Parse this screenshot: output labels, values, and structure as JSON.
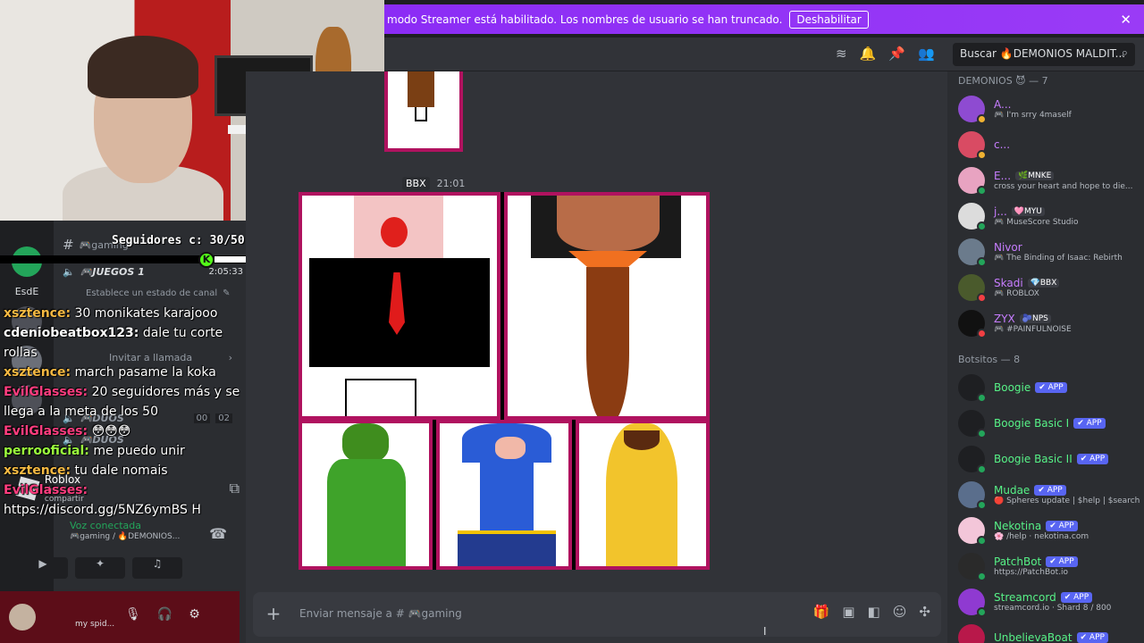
{
  "banner": {
    "text": "modo Streamer está habilitado. Los nombres de usuario se han truncado.",
    "button": "Deshabilitar",
    "close_icon": "close-icon"
  },
  "header": {
    "search_text": "Buscar 🔥DEMONIOS MALDIT..."
  },
  "stream_overlay": {
    "followers_label": "Seguidores c: 30/50",
    "followers_progress": 0.6,
    "followers_dot": "K"
  },
  "channels": {
    "items": [
      {
        "label": "🎮gaming"
      },
      {
        "label": "🎮JUEGOS 1"
      },
      {
        "label": "Establece un estado de canal"
      },
      {
        "label": "Invitar a llamada"
      },
      {
        "label": "🎮DUOS"
      },
      {
        "label": "🎮DUOS"
      }
    ],
    "time_code": "2:05:33",
    "duo_count_a": "00",
    "duo_count_b": "02",
    "server_label": "EsdE"
  },
  "chat_overlay": [
    {
      "user": "xsztence:",
      "text": "30 monikates karajooo",
      "color": "#f5b942"
    },
    {
      "user": "cdeniobeatbox123:",
      "text": "dale tu corte rollas",
      "color": "#ffffff"
    },
    {
      "user": "xsztence:",
      "text": "march pasame la koka",
      "color": "#f5b942"
    },
    {
      "user": "EvilGlasses:",
      "text": "20 seguidores más y se llega a la meta de los 50",
      "color": "#ff3d7f"
    },
    {
      "user": "EvilGlasses:",
      "text": "😳😳😳",
      "color": "#ff3d7f"
    },
    {
      "user": "perrooficial:",
      "text": "me puedo unir",
      "color": "#9bff3d"
    },
    {
      "user": "xsztence:",
      "text": "tu dale nomais",
      "color": "#f5b942"
    },
    {
      "user": "EvilGlasses:",
      "text": "https://discord.gg/5NZ6ymBS H",
      "color": "#ff3d7f"
    }
  ],
  "voice_panel": {
    "activity": "Roblox",
    "activity_sub": "No compartir",
    "voice_status": "Voz conectada",
    "voice_sub": "🎮gaming / 🔥DEMONIOS..."
  },
  "user_panel": {
    "name": "my spid..."
  },
  "message": {
    "tag": "BBX",
    "time": "21:01"
  },
  "composer": {
    "placeholder": "Enviar mensaje a # 🎮gaming"
  },
  "members": {
    "groups": [
      {
        "title": "DEMONIOS 😈 — 7",
        "items": [
          {
            "name": "A...",
            "sub": "🎮 I'm srry 4maself",
            "color": "#c77dff",
            "avatar": "#8e4bd1",
            "status": "#f0b232",
            "tag": ""
          },
          {
            "name": "c...",
            "sub": "",
            "color": "#c77dff",
            "avatar": "#d94b63",
            "status": "#f0b232",
            "tag": ""
          },
          {
            "name": "E...",
            "sub": "cross your heart and hope to die...",
            "color": "#c77dff",
            "avatar": "#e8a3c1",
            "status": "#23a55a",
            "tag": "🌿MNKE"
          },
          {
            "name": "j...",
            "sub": "🎮 MuseScore Studio",
            "color": "#c77dff",
            "avatar": "#dcdcdc",
            "status": "#23a55a",
            "tag": "🩷MYU"
          },
          {
            "name": "Nivor",
            "sub": "🎮 The Binding of Isaac: Rebirth",
            "color": "#c77dff",
            "avatar": "#6b7b8c",
            "status": "#23a55a",
            "tag": ""
          },
          {
            "name": "Skadi",
            "sub": "🎮 ROBLOX",
            "color": "#c77dff",
            "avatar": "#4a5a2c",
            "status": "#f23f43",
            "tag": "💎BBX"
          },
          {
            "name": "ZYX",
            "sub": "🎮 #PAINFULNOISE",
            "color": "#c77dff",
            "avatar": "#111111",
            "status": "#f23f43",
            "tag": "🫐NPS"
          }
        ]
      },
      {
        "title": "Botsitos — 8",
        "items": [
          {
            "name": "Boogie",
            "sub": "",
            "color": "#57f287",
            "avatar": "#1e1f22",
            "status": "#23a55a",
            "tag": "✔ APP"
          },
          {
            "name": "Boogie Basic I",
            "sub": "",
            "color": "#57f287",
            "avatar": "#1e1f22",
            "status": "#23a55a",
            "tag": "✔ APP"
          },
          {
            "name": "Boogie Basic II",
            "sub": "",
            "color": "#57f287",
            "avatar": "#1e1f22",
            "status": "#23a55a",
            "tag": "✔ APP"
          },
          {
            "name": "Mudae",
            "sub": "🔴 Spheres update | $help | $search",
            "color": "#57f287",
            "avatar": "#5a6e8c",
            "status": "#23a55a",
            "tag": "✔ APP"
          },
          {
            "name": "Nekotina",
            "sub": "🌸 /help · nekotina.com",
            "color": "#57f287",
            "avatar": "#f3c6d9",
            "status": "#23a55a",
            "tag": "✔ APP"
          },
          {
            "name": "PatchBot",
            "sub": "https://PatchBot.io",
            "color": "#57f287",
            "avatar": "#2a2a2a",
            "status": "#23a55a",
            "tag": "✔ APP"
          },
          {
            "name": "Streamcord",
            "sub": "streamcord.io · Shard 8 / 800",
            "color": "#57f287",
            "avatar": "#8f3ad1",
            "status": "#23a55a",
            "tag": "✔ APP"
          },
          {
            "name": "UnbelievaBoat",
            "sub": "",
            "color": "#57f287",
            "avatar": "#b8184a",
            "status": "#23a55a",
            "tag": "✔ APP"
          }
        ]
      }
    ]
  }
}
